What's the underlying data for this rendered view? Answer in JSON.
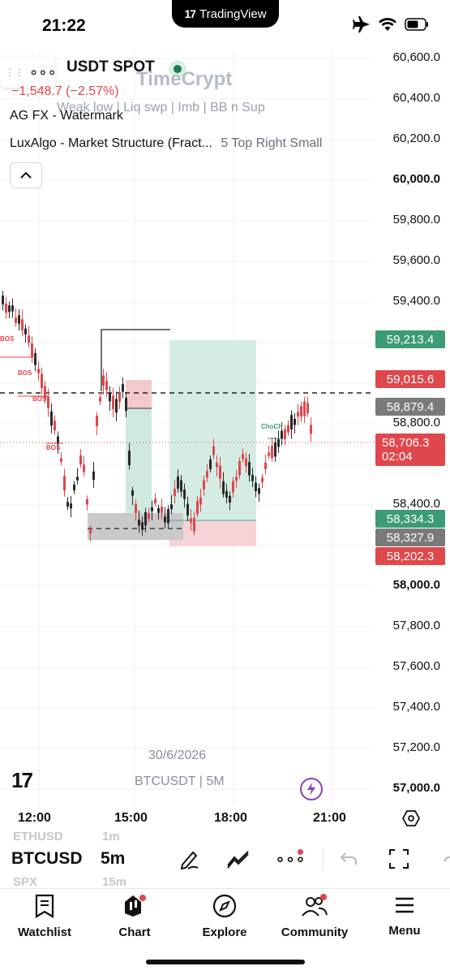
{
  "status_bar": {
    "time": "21:22",
    "app_pill": "TradingView",
    "app_pill_logo": "17"
  },
  "chart": {
    "symbol_title": "USDT SPOT",
    "change": "−1,548.7 (−2.57%)",
    "indicator_1": "AG FX - Watermark",
    "indicator_2": "LuxAlgo - Market Structure (Fract...",
    "indicator_2_params": "5  Top Right  Small",
    "overlay_brand": "TimeCrypt",
    "overlay_tags": "Weak low  |  Liq swp |  Imb  | BB n Sup",
    "price_axis": [
      "60,600.0",
      "60,400.0",
      "60,200.0",
      "60,000.0",
      "59,800.0",
      "59,600.0",
      "59,400.0",
      "58,800.0",
      "58,400.0",
      "58,000.0",
      "57,800.0",
      "57,600.0",
      "57,400.0",
      "57,200.0",
      "57,000.0"
    ],
    "tags": {
      "tp": "59,213.4",
      "level1": "59,015.6",
      "level2": "58,879.4",
      "last_price": "58,706.3",
      "countdown": "02:04",
      "entry": "58,334.3",
      "level3": "58,327.9",
      "sl": "58,202.3"
    },
    "structure_labels": {
      "bos": "BOS",
      "choch": "ChoCh"
    },
    "watermark_date": "30/6/2026",
    "watermark_symbol": "BTCUSDT | 5M",
    "time_axis": [
      "12:00",
      "15:00",
      "18:00",
      "21:00"
    ],
    "colors": {
      "up": "#2a2a2a",
      "down": "#e0474c",
      "green_tag": "#3c9b74",
      "red_tag": "#e0474c",
      "gray_tag": "#7a7a7a"
    }
  },
  "toolbar": {
    "symbol": "BTCUSD",
    "interval": "5m",
    "ghost_symbol_above": "ETHUSD",
    "ghost_interval_above": "1m",
    "ghost_symbol_below": "SPX",
    "ghost_interval_below": "15m"
  },
  "nav": {
    "watchlist": "Watchlist",
    "chart": "Chart",
    "explore": "Explore",
    "community": "Community",
    "menu": "Menu"
  }
}
